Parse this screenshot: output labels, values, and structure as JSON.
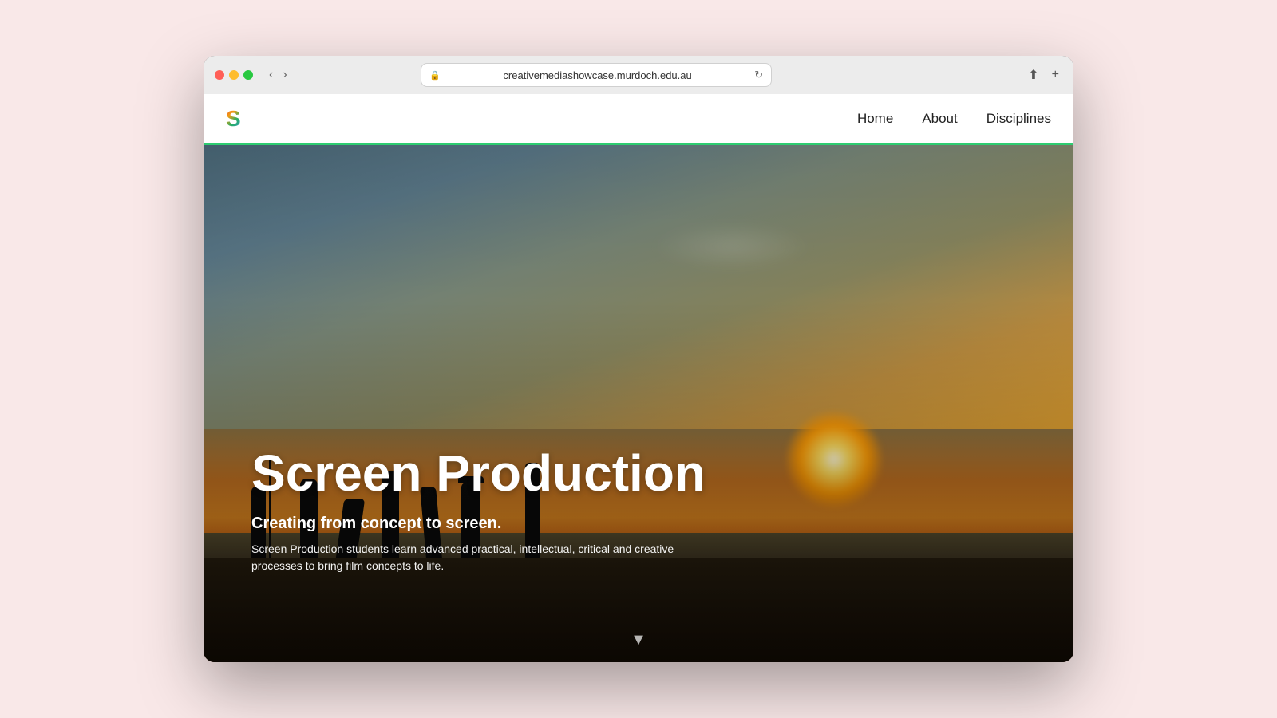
{
  "browser": {
    "url": "creativemediashowcase.murdoch.edu.au",
    "back_label": "‹",
    "forward_label": "›",
    "share_label": "⬆",
    "new_tab_label": "+"
  },
  "site": {
    "logo_text": "S",
    "nav": {
      "items": [
        {
          "label": "Home",
          "href": "#"
        },
        {
          "label": "About",
          "href": "#"
        },
        {
          "label": "Disciplines",
          "href": "#"
        }
      ]
    }
  },
  "hero": {
    "title": "Screen Production",
    "subtitle": "Creating from concept to screen.",
    "description": "Screen Production students learn advanced practical, intellectual, critical and creative processes to bring film concepts to life.",
    "scroll_indicator": "▼"
  }
}
